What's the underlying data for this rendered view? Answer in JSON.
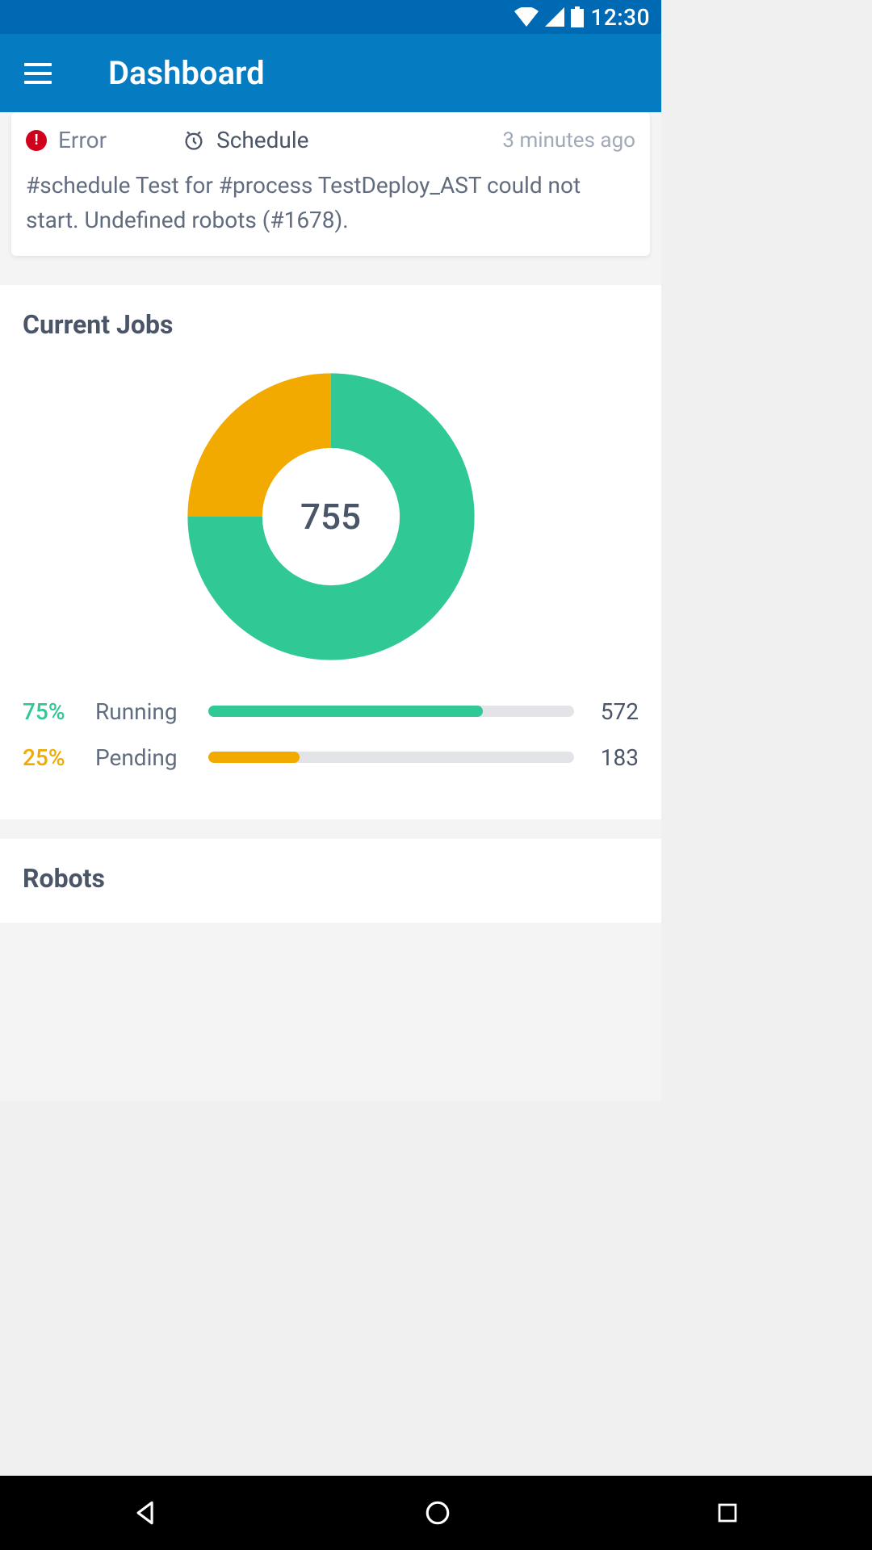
{
  "status": {
    "time": "12:30"
  },
  "header": {
    "title": "Dashboard"
  },
  "alert": {
    "error_label": "Error",
    "schedule_label": "Schedule",
    "time_ago": "3 minutes ago",
    "message": "#schedule Test for #process TestDeploy_AST could not start. Undefined robots (#1678)."
  },
  "current_jobs": {
    "title": "Current Jobs",
    "center_value": "755",
    "items": [
      {
        "percent": "75%",
        "label": "Running",
        "value": "572",
        "fill": 75,
        "color": "#30c894"
      },
      {
        "percent": "25%",
        "label": "Pending",
        "value": "183",
        "fill": 25,
        "color": "#f2a900"
      }
    ]
  },
  "robots": {
    "title": "Robots"
  },
  "colors": {
    "green": "#30c894",
    "amber": "#f2a900"
  },
  "chart_data": {
    "type": "pie",
    "title": "Current Jobs",
    "total": 755,
    "series": [
      {
        "name": "Running",
        "value": 572,
        "percent": 75,
        "color": "#30c894"
      },
      {
        "name": "Pending",
        "value": 183,
        "percent": 25,
        "color": "#f2a900"
      }
    ]
  }
}
